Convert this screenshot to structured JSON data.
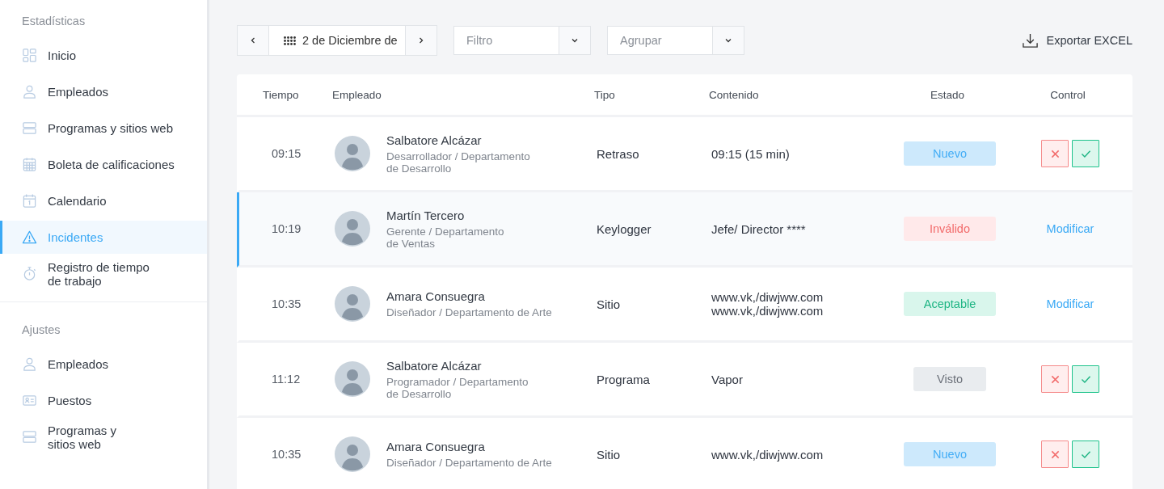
{
  "sidebar": {
    "sections": [
      {
        "title": "Estadísticas",
        "items": [
          {
            "label_lines": [
              "Inicio"
            ],
            "selected": false
          },
          {
            "label_lines": [
              "Empleados"
            ],
            "selected": false
          },
          {
            "label_lines": [
              "Programas y sitios web"
            ],
            "selected": false
          },
          {
            "label_lines": [
              "Boleta de calificaciones"
            ],
            "selected": false
          },
          {
            "label_lines": [
              "Calendario"
            ],
            "selected": false
          },
          {
            "label_lines": [
              "Incidentes"
            ],
            "selected": true
          },
          {
            "label_lines": [
              "Registro de tiempo",
              "de trabajo"
            ],
            "selected": false
          }
        ]
      },
      {
        "title": "Ajustes",
        "items": [
          {
            "label_lines": [
              "Empleados"
            ],
            "selected": false
          },
          {
            "label_lines": [
              "Puestos"
            ],
            "selected": false
          },
          {
            "label_lines": [
              "Programas y",
              "sitios web"
            ],
            "selected": false
          }
        ]
      }
    ]
  },
  "toolbar": {
    "date": "2 de Diciembre de",
    "filter": {
      "placeholder": "Filtro"
    },
    "group": {
      "placeholder": "Agrupar"
    },
    "export": "Exportar EXCEL"
  },
  "table": {
    "columns": [
      "Tiempo",
      "Empleado",
      "Tipo",
      "Contenido",
      "Estado",
      "Control"
    ],
    "rows": [
      {
        "time": "09:15",
        "name": "Salbatore Alcázar",
        "role_lines": [
          "Desarrollador / Departamento",
          "de Desarrollo"
        ],
        "type": "Retraso",
        "content": [
          "09:15 (15 min)"
        ],
        "status": {
          "kind": "new",
          "label": "Nuevo"
        },
        "control": {
          "kind": "buttons"
        },
        "selected": false
      },
      {
        "time": "10:19",
        "name": "Martín Tercero",
        "role_lines": [
          "Gerente / Departamento",
          "de Ventas"
        ],
        "type": "Keylogger",
        "content": [
          "Jefe/ Director ****"
        ],
        "status": {
          "kind": "invalid",
          "label": "Inválido"
        },
        "control": {
          "kind": "link",
          "label": "Modificar"
        },
        "selected": true
      },
      {
        "time": "10:35",
        "name": "Amara Consuegra",
        "role_lines": [
          "Diseñador / Departamento de Arte"
        ],
        "type": "Sitio",
        "content": [
          "www.vk,/diwjww.com",
          "www.vk,/diwjww.com"
        ],
        "status": {
          "kind": "accepted",
          "label": "Aceptable"
        },
        "control": {
          "kind": "link",
          "label": "Modificar"
        },
        "selected": false
      },
      {
        "time": "11:12",
        "name": "Salbatore Alcázar",
        "role_lines": [
          "Programador / Departamento",
          "de Desarrollo"
        ],
        "type": "Programa",
        "content": [
          "Vapor"
        ],
        "status": {
          "kind": "seen",
          "label": "Visto"
        },
        "control": {
          "kind": "buttons"
        },
        "selected": false
      },
      {
        "time": "10:35",
        "name": "Amara Consuegra",
        "role_lines": [
          "Diseñador / Departamento de Arte"
        ],
        "type": "Sitio",
        "content": [
          "www.vk,/diwjww.com"
        ],
        "status": {
          "kind": "new",
          "label": "Nuevo"
        },
        "control": {
          "kind": "buttons"
        },
        "selected": false
      }
    ]
  }
}
